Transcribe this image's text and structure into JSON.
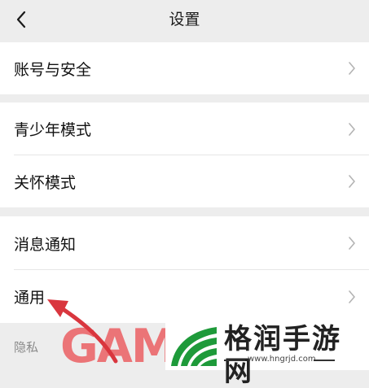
{
  "header": {
    "title": "设置",
    "back_icon": "chevron-left-icon"
  },
  "rows": [
    {
      "label": "账号与安全"
    },
    {
      "label": "青少年模式"
    },
    {
      "label": "关怀模式"
    },
    {
      "label": "消息通知"
    },
    {
      "label": "通用"
    }
  ],
  "section": {
    "partial_label": "隐私"
  },
  "watermark": {
    "left_text": "GAM",
    "site_name": "格润手游网",
    "site_url": "www.hngrjd.com",
    "logo_icon": "green-arch-logo-icon"
  },
  "colors": {
    "background": "#ededed",
    "card": "#ffffff",
    "arrow": "#d9363e",
    "watermark_red": "#eb6a6d",
    "logo_green": "#1e9a3a"
  }
}
